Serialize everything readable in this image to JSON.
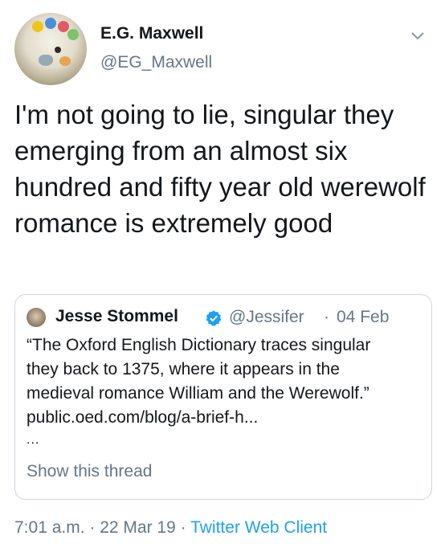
{
  "author": {
    "display_name": "E.G. Maxwell",
    "handle": "@EG_Maxwell",
    "menu_icon": "chevron-down-icon"
  },
  "tweet": {
    "text": "I'm not going to lie, singular they emerging from an almost six hundred and fifty year old werewolf romance is extremely good"
  },
  "quoted_tweet": {
    "display_name": "Jesse Stommel",
    "verified_icon": "verified-badge-icon",
    "handle": "@Jessifer",
    "separator": "·",
    "date": "04 Feb",
    "text_line_1": "“The Oxford English Dictionary traces singular",
    "text_line_2": "they back to 1375, where it appears in the",
    "text_line_3": "medieval romance William and the Werewolf.”",
    "text_line_4": "public.oed.com/blog/a-brief-h...",
    "ellipsis": "...",
    "show_thread": "Show this thread"
  },
  "footer": {
    "time": "7:01 a.m.",
    "sep1": " · ",
    "date": "22 Mar 19",
    "sep2": " · ",
    "client": "Twitter Web Client"
  },
  "colors": {
    "text": "#14171a",
    "secondary": "#657786",
    "link": "#1da1f2",
    "border": "#ccd6dd"
  }
}
